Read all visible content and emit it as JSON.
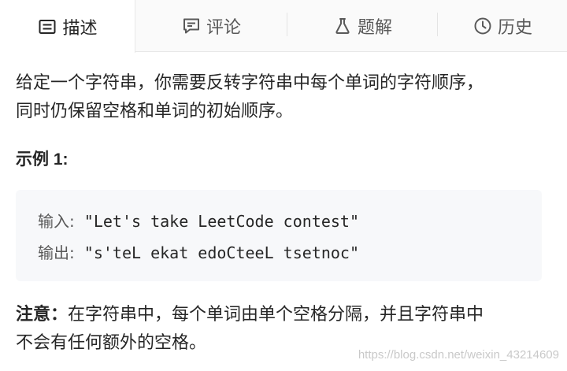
{
  "tabs": [
    {
      "label": "描述",
      "icon": "description-icon",
      "active": true
    },
    {
      "label": "评论",
      "icon": "comment-icon",
      "active": false
    },
    {
      "label": "题解",
      "icon": "flask-icon",
      "active": false
    },
    {
      "label": "历史",
      "icon": "clock-icon",
      "active": false
    }
  ],
  "problem": {
    "line1": "给定一个字符串，你需要反转字符串中每个单词的字符顺序，",
    "line2": "同时仍保留空格和单词的初始顺序。",
    "example_title": "示例 1:",
    "input_label": "输入:",
    "input_value": " \"Let's take LeetCode contest\"",
    "output_label": "输出:",
    "output_value": " \"s'teL ekat edoCteeL tsetnoc\"",
    "note_label": "注意：",
    "note_line1": "在字符串中，每个单词由单个空格分隔，并且字符串中",
    "note_line2": "不会有任何额外的空格。"
  },
  "watermark": "https://blog.csdn.net/weixin_43214609",
  "colors": {
    "tab_bg": "#fafafa",
    "active_tab_bg": "#ffffff",
    "code_bg": "#f7f8fa",
    "text": "#262626"
  }
}
